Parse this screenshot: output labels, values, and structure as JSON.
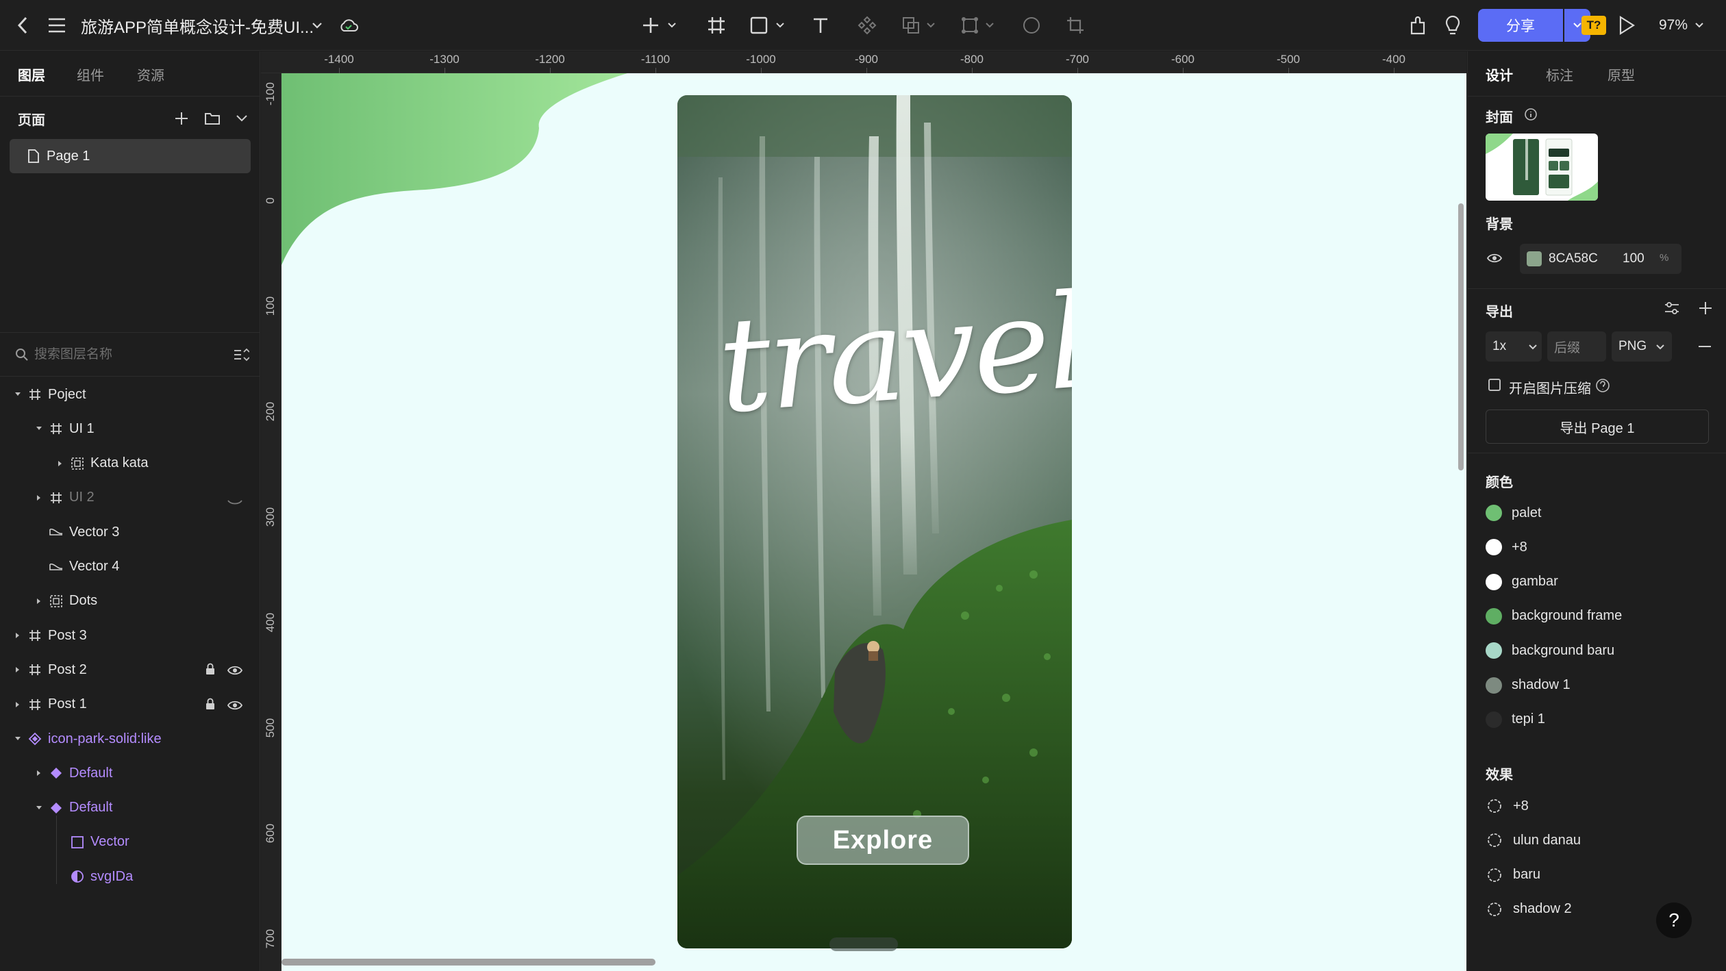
{
  "toolbar": {
    "title": "旅游APP简单概念设计-免费UI...",
    "share_label": "分享",
    "badge_label": "T?",
    "zoom": "97%"
  },
  "left_panel": {
    "tabs": [
      "图层",
      "组件",
      "资源"
    ],
    "pages_label": "页面",
    "page_item": "Page 1",
    "search_placeholder": "搜索图层名称",
    "layers": [
      {
        "name": "Poject",
        "depth": 0,
        "icon": "frame-icon",
        "caret": "down"
      },
      {
        "name": "UI 1",
        "depth": 1,
        "icon": "frame-icon",
        "caret": "down"
      },
      {
        "name": "Kata kata",
        "depth": 2,
        "icon": "group-icon",
        "caret": "right"
      },
      {
        "name": "UI 2",
        "depth": 1,
        "icon": "frame-icon",
        "caret": "right",
        "hidden": true
      },
      {
        "name": "Vector 3",
        "depth": 1,
        "icon": "vector-icon",
        "caret": ""
      },
      {
        "name": "Vector 4",
        "depth": 1,
        "icon": "vector-icon",
        "caret": ""
      },
      {
        "name": "Dots",
        "depth": 1,
        "icon": "group-icon",
        "caret": "right"
      },
      {
        "name": "Post 3",
        "depth": 0,
        "icon": "frame-icon",
        "caret": "right"
      },
      {
        "name": "Post 2",
        "depth": 0,
        "icon": "frame-icon",
        "caret": "right",
        "locked": true
      },
      {
        "name": "Post 1",
        "depth": 0,
        "icon": "frame-icon",
        "caret": "right",
        "locked": true
      },
      {
        "name": "icon-park-solid:like",
        "depth": 0,
        "icon": "component-icon",
        "caret": "down",
        "purple": true
      },
      {
        "name": "Default",
        "depth": 1,
        "icon": "instance-icon",
        "caret": "right",
        "purple": true
      },
      {
        "name": "Default",
        "depth": 1,
        "icon": "instance-icon",
        "caret": "down",
        "purple": true
      },
      {
        "name": "Vector",
        "depth": 2,
        "icon": "rect-icon",
        "caret": "",
        "purple": true
      },
      {
        "name": "svgIDa",
        "depth": 2,
        "icon": "mask-icon",
        "caret": "",
        "purple": true
      }
    ]
  },
  "rulers": {
    "top": [
      "-1400",
      "-1300",
      "-1200",
      "-1100",
      "-1000",
      "-900",
      "-800",
      "-700",
      "-600",
      "-500",
      "-400"
    ],
    "left": [
      "-100",
      "0",
      "100",
      "200",
      "300",
      "400",
      "500",
      "600",
      "700"
    ]
  },
  "canvas": {
    "headline": "travel",
    "button_label": "Explore",
    "background_color": "#ECFDFC"
  },
  "right_panel": {
    "tabs": [
      "设计",
      "标注",
      "原型"
    ],
    "cover_label": "封面",
    "background_label": "背景",
    "background_hex": "8CA58C",
    "background_opacity": "100",
    "percent_sign": "%",
    "export_label": "导出",
    "export_scale": "1x",
    "suffix_placeholder": "后缀",
    "export_format": "PNG",
    "compress_label": "开启图片压缩",
    "export_button": "导出 Page 1",
    "colors_label": "颜色",
    "colors": [
      {
        "name": "palet",
        "color": "#6fbf73"
      },
      {
        "name": "+8",
        "color": "#ffffff"
      },
      {
        "name": "gambar",
        "color": "#ffffff"
      },
      {
        "name": "background frame",
        "color": "#5fae63"
      },
      {
        "name": "background baru",
        "color": "#a8d8c8"
      },
      {
        "name": "shadow 1",
        "color": "#7d8a80"
      },
      {
        "name": "tepi 1",
        "color": "#2b2b2b"
      }
    ],
    "effects_label": "效果",
    "effects": [
      "+8",
      "ulun danau",
      "baru",
      "shadow 2"
    ],
    "help_label": "?"
  }
}
